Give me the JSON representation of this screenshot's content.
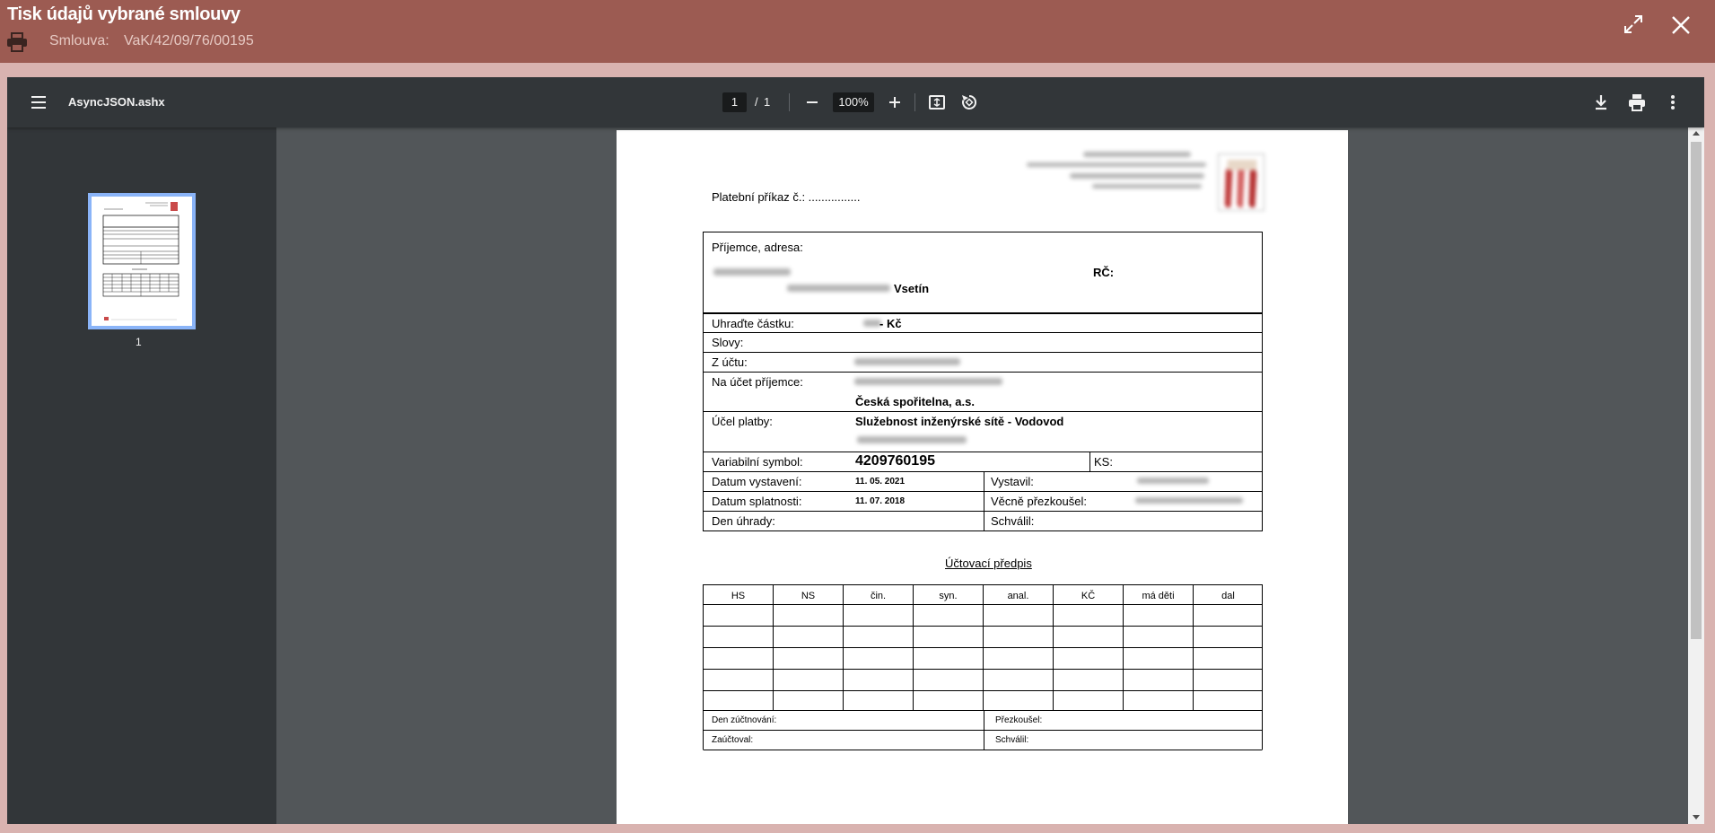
{
  "dialog": {
    "title": "Tisk údajů vybrané smlouvy",
    "contract_label": "Smlouva:",
    "contract_value": "VaK/42/09/76/00195"
  },
  "viewer": {
    "file_name": "AsyncJSON.ashx",
    "page_current": "1",
    "page_sep": "/",
    "page_total": "1",
    "zoom": "100%",
    "thumb_label": "1"
  },
  "document": {
    "order_label": "Platební příkaz č.: ................",
    "recipient_label": "Příjemce, adresa:",
    "city": "Vsetín",
    "rc_label": "RČ:",
    "amount_label": "Uhraďte částku:",
    "currency": "- Kč",
    "words_label": "Slovy:",
    "from_account_label": "Z účtu:",
    "to_account_label": "Na účet příjemce:",
    "bank": "Česká spořitelna, a.s.",
    "purpose_label": "Účel platby:",
    "purpose": "Služebnost inženýrské sítě - Vodovod",
    "vs_label": "Variabilní symbol:",
    "vs": "4209760195",
    "ks_label": "KS:",
    "issued_label": "Datum vystavení:",
    "issued": "11. 05. 2021",
    "issuer_label": "Vystavil:",
    "due_label": "Datum splatnosti:",
    "due": "11. 07. 2018",
    "checker_label": "Věcně přezkoušel:",
    "payday_label": "Den úhrady:",
    "approved_label": "Schválil:",
    "accounting_title": "Účtovací předpis",
    "accounting_headers": [
      "HS",
      "NS",
      "čin.",
      "syn.",
      "anal.",
      "KČ",
      "má děti",
      "dal"
    ],
    "posting_date_label": "Den zúčtnování:",
    "reviewer_label": "Přezkoušel:",
    "posted_by_label": "Zaúčtoval:",
    "approved2_label": "Schválil:"
  },
  "colors": {
    "header_bg": "#9c5b52",
    "page_bg": "#d9b3b0",
    "toolbar_bg": "#323639",
    "viewer_bg": "#525659",
    "thumb_border": "#8ab4f8"
  }
}
